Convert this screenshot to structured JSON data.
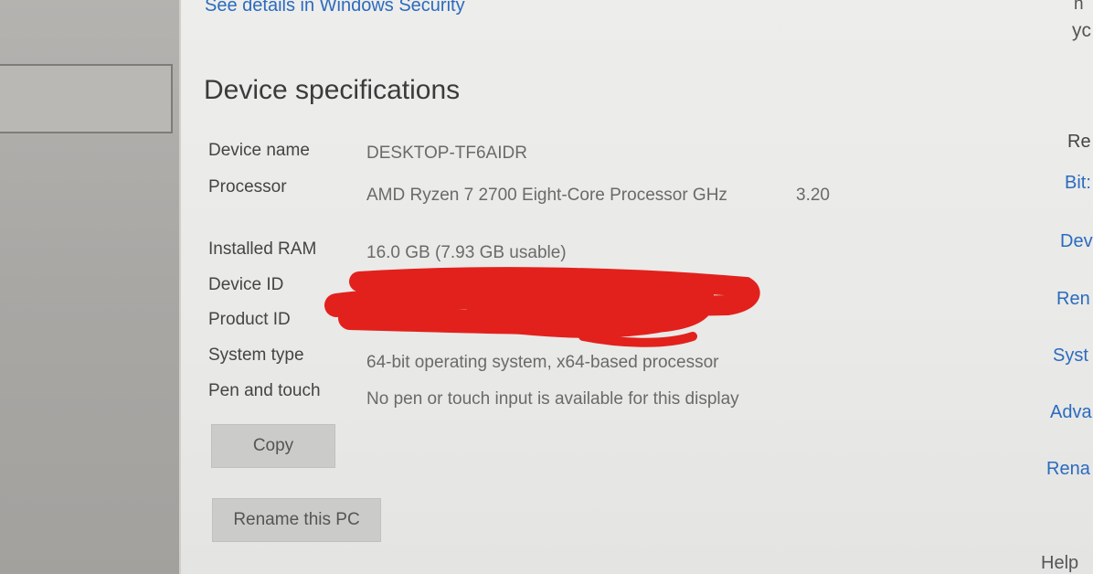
{
  "header": {
    "security_link": "See details in Windows Security"
  },
  "section": {
    "title": "Device specifications"
  },
  "specs": [
    {
      "label": "Device name",
      "value": "DESKTOP-TF6AIDR"
    },
    {
      "label": "Processor",
      "value": "AMD Ryzen 7 2700 Eight-Core Processor GHz",
      "extra": "3.20"
    },
    {
      "label": "Installed RAM",
      "value": "16.0 GB (7.93 GB usable)"
    },
    {
      "label": "Device ID",
      "value": ""
    },
    {
      "label": "Product ID",
      "value": ""
    },
    {
      "label": "System type",
      "value": "64-bit operating system, x64-based processor"
    },
    {
      "label": "Pen and touch",
      "value": "No pen or touch input is available for this display"
    }
  ],
  "buttons": {
    "copy": "Copy",
    "rename": "Rename this PC"
  },
  "right_panel": {
    "top_text_1": "n",
    "top_text_2": "yc",
    "heading": "Re",
    "links": [
      "Bit:",
      "Dev",
      "Ren",
      "Syst",
      "Adva",
      "Rena"
    ],
    "help": "Help"
  },
  "colors": {
    "link": "#2b6bbf",
    "redaction": "#e2211c"
  }
}
